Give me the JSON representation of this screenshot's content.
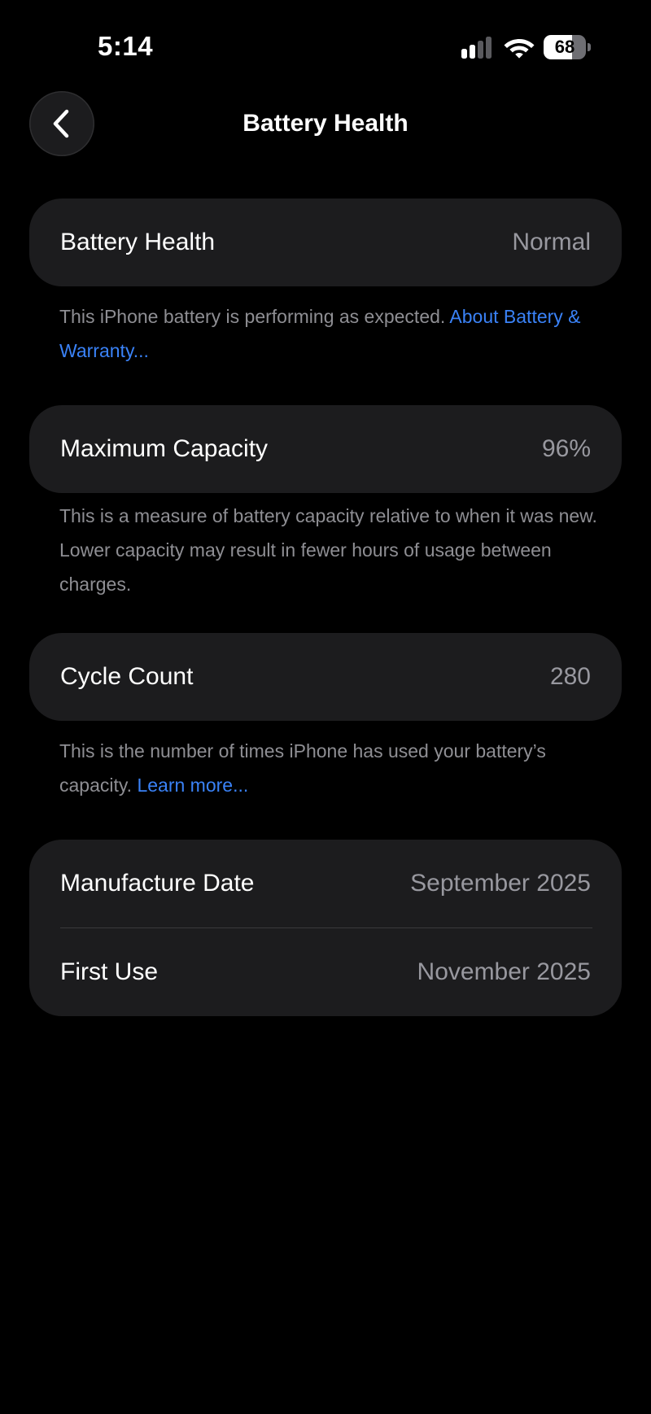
{
  "status_bar": {
    "time": "5:14",
    "battery_level": "68",
    "battery_fraction": 0.68,
    "signal_icon": "cellular-signal-icon",
    "wifi_icon": "wifi-icon",
    "battery_icon": "battery-icon"
  },
  "nav": {
    "title": "Battery Health",
    "back_icon": "chevron-left-icon"
  },
  "sections": {
    "health": {
      "label": "Battery Health",
      "value": "Normal",
      "footnote_text": "This iPhone battery is performing as expected. ",
      "footnote_link": "About Battery & Warranty..."
    },
    "capacity": {
      "label": "Maximum Capacity",
      "value": "96%",
      "footnote_text": "This is a measure of battery capacity relative to when it was new. Lower capacity may result in fewer hours of usage between charges."
    },
    "cycles": {
      "label": "Cycle Count",
      "value": "280",
      "footnote_text": "This is the number of times iPhone has used your battery’s capacity. ",
      "footnote_link": "Learn more..."
    },
    "dates": {
      "manufacture_label": "Manufacture Date",
      "manufacture_value": "September 2025",
      "first_use_label": "First Use",
      "first_use_value": "November 2025"
    }
  },
  "colors": {
    "background": "#000000",
    "card": "#1c1c1e",
    "secondary_text": "#98989f",
    "link": "#3a82f7"
  }
}
